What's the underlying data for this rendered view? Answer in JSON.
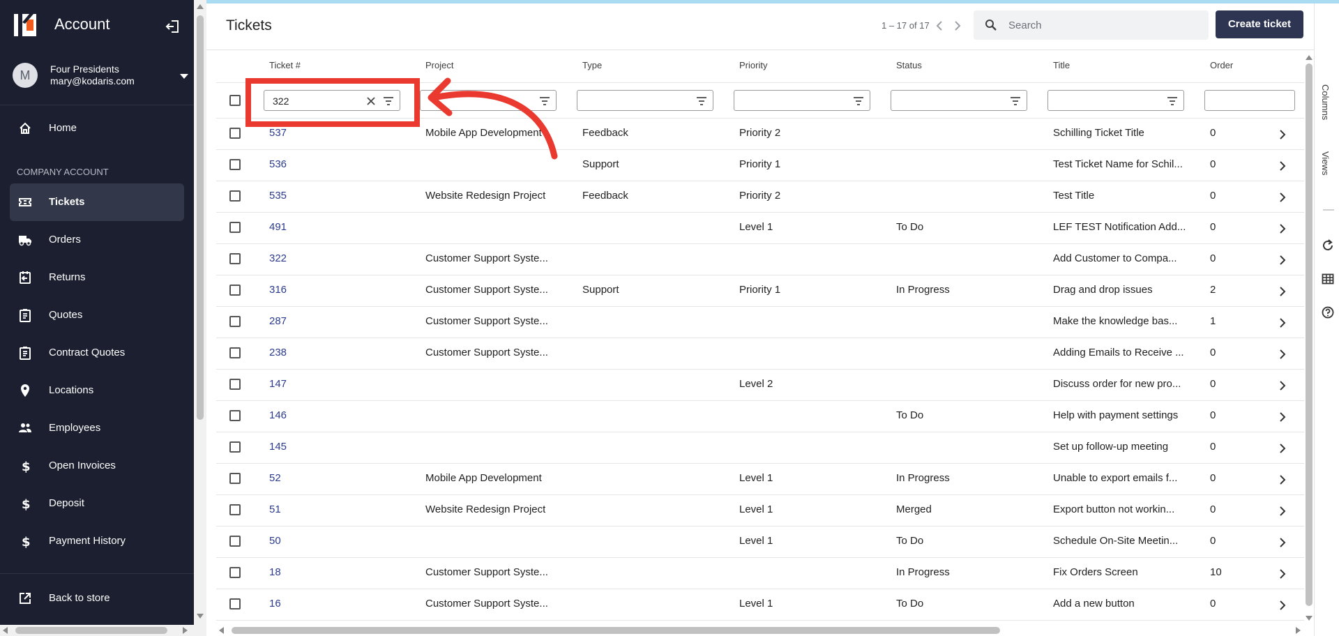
{
  "sidebar": {
    "app_title": "Account",
    "user": {
      "initial": "M",
      "name": "Four Presidents",
      "email": "mary@kodaris.com"
    },
    "home_label": "Home",
    "section_label": "COMPANY ACCOUNT",
    "items": [
      {
        "label": "Tickets",
        "icon": "ticket-icon",
        "active": true
      },
      {
        "label": "Orders",
        "icon": "truck-icon"
      },
      {
        "label": "Returns",
        "icon": "return-icon"
      },
      {
        "label": "Quotes",
        "icon": "clipboard-icon"
      },
      {
        "label": "Contract Quotes",
        "icon": "clipboard-icon"
      },
      {
        "label": "Locations",
        "icon": "location-pin-icon"
      },
      {
        "label": "Employees",
        "icon": "people-icon"
      },
      {
        "label": "Open Invoices",
        "icon": "dollar-icon"
      },
      {
        "label": "Deposit",
        "icon": "dollar-icon"
      },
      {
        "label": "Payment History",
        "icon": "dollar-icon"
      }
    ],
    "back_label": "Back to store"
  },
  "header": {
    "title": "Tickets",
    "pager": "1 – 17 of 17",
    "search_placeholder": "Search",
    "create_label": "Create ticket"
  },
  "grid": {
    "columns": [
      "Ticket #",
      "Project",
      "Type",
      "Priority",
      "Status",
      "Title",
      "Order"
    ],
    "filter_ticket_value": "322",
    "rows": [
      {
        "num": "537",
        "project": "Mobile App Development",
        "type": "Feedback",
        "priority": "Priority 2",
        "status": "",
        "title": "Schilling Ticket Title",
        "order": "0"
      },
      {
        "num": "536",
        "project": "",
        "type": "Support",
        "priority": "Priority 1",
        "status": "",
        "title": "Test Ticket Name for Schil...",
        "order": "0"
      },
      {
        "num": "535",
        "project": "Website Redesign Project",
        "type": "Feedback",
        "priority": "Priority 2",
        "status": "",
        "title": "Test Title",
        "order": "0"
      },
      {
        "num": "491",
        "project": "",
        "type": "",
        "priority": "Level 1",
        "status": "To Do",
        "title": "LEF TEST Notification Add...",
        "order": "0"
      },
      {
        "num": "322",
        "project": "Customer Support Syste...",
        "type": "",
        "priority": "",
        "status": "",
        "title": "Add Customer to Compa...",
        "order": "0"
      },
      {
        "num": "316",
        "project": "Customer Support Syste...",
        "type": "Support",
        "priority": "Priority 1",
        "status": "In Progress",
        "title": "Drag and drop issues",
        "order": "2"
      },
      {
        "num": "287",
        "project": "Customer Support Syste...",
        "type": "",
        "priority": "",
        "status": "",
        "title": "Make the knowledge bas...",
        "order": "1"
      },
      {
        "num": "238",
        "project": "Customer Support Syste...",
        "type": "",
        "priority": "",
        "status": "",
        "title": "Adding Emails to Receive ...",
        "order": "0"
      },
      {
        "num": "147",
        "project": "",
        "type": "",
        "priority": "Level 2",
        "status": "",
        "title": "Discuss order for new pro...",
        "order": "0"
      },
      {
        "num": "146",
        "project": "",
        "type": "",
        "priority": "",
        "status": "To Do",
        "title": "Help with payment settings",
        "order": "0"
      },
      {
        "num": "145",
        "project": "",
        "type": "",
        "priority": "",
        "status": "",
        "title": "Set up follow-up meeting",
        "order": "0"
      },
      {
        "num": "52",
        "project": "Mobile App Development",
        "type": "",
        "priority": "Level 1",
        "status": "In Progress",
        "title": "Unable to export emails f...",
        "order": "0"
      },
      {
        "num": "51",
        "project": "Website Redesign Project",
        "type": "",
        "priority": "Level 1",
        "status": "Merged",
        "title": "Export button not workin...",
        "order": "0"
      },
      {
        "num": "50",
        "project": "",
        "type": "",
        "priority": "Level 1",
        "status": "To Do",
        "title": "Schedule On-Site Meetin...",
        "order": "0"
      },
      {
        "num": "18",
        "project": "Customer Support Syste...",
        "type": "",
        "priority": "",
        "status": "In Progress",
        "title": "Fix Orders Screen",
        "order": "10"
      },
      {
        "num": "16",
        "project": "Customer Support Syste...",
        "type": "",
        "priority": "Level 1",
        "status": "To Do",
        "title": "Add a new button",
        "order": "0"
      }
    ]
  },
  "tool_panel": {
    "columns_label": "Columns",
    "views_label": "Views"
  },
  "colors": {
    "sidebar_bg": "#1b1f2f",
    "primary_button": "#2e3552",
    "link": "#2b3a8c",
    "annotation": "#ea3a2f"
  }
}
